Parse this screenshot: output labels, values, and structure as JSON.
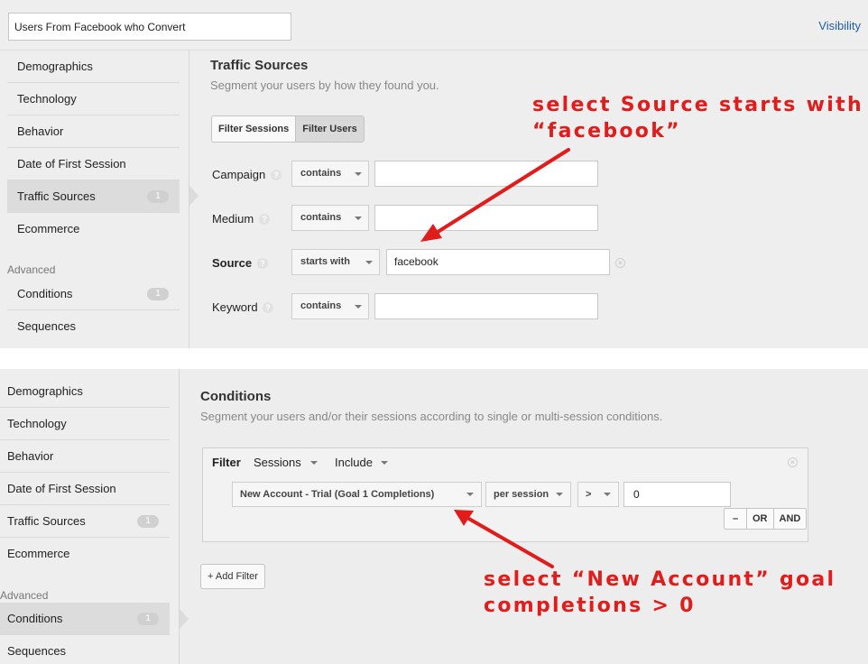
{
  "top_panel": {
    "segment_name": "Users From Facebook who Convert",
    "visibility_link": "Visibility",
    "sidebar": {
      "items": [
        {
          "label": "Demographics",
          "badge": ""
        },
        {
          "label": "Technology",
          "badge": ""
        },
        {
          "label": "Behavior",
          "badge": ""
        },
        {
          "label": "Date of First Session",
          "badge": ""
        },
        {
          "label": "Traffic Sources",
          "badge": "1",
          "active": true
        },
        {
          "label": "Ecommerce",
          "badge": ""
        }
      ],
      "advanced_label": "Advanced",
      "advanced_items": [
        {
          "label": "Conditions",
          "badge": "1"
        },
        {
          "label": "Sequences",
          "badge": ""
        }
      ]
    },
    "section_title": "Traffic Sources",
    "section_subtitle": "Segment your users by how they found you.",
    "toggle": {
      "sessions": "Filter Sessions",
      "users": "Filter Users",
      "selected": "Filter Users"
    },
    "fields": [
      {
        "label": "Campaign",
        "operator": "contains",
        "value": ""
      },
      {
        "label": "Medium",
        "operator": "contains",
        "value": ""
      },
      {
        "label": "Source",
        "operator": "starts with",
        "value": "facebook"
      },
      {
        "label": "Keyword",
        "operator": "contains",
        "value": ""
      }
    ],
    "help_glyph": "?",
    "annotation": "select Source starts with\n“facebook”"
  },
  "bottom_panel": {
    "sidebar": {
      "items": [
        {
          "label": "Demographics",
          "badge": ""
        },
        {
          "label": "Technology",
          "badge": ""
        },
        {
          "label": "Behavior",
          "badge": ""
        },
        {
          "label": "Date of First Session",
          "badge": ""
        },
        {
          "label": "Traffic Sources",
          "badge": "1"
        },
        {
          "label": "Ecommerce",
          "badge": ""
        }
      ],
      "advanced_label": "Advanced",
      "advanced_items": [
        {
          "label": "Conditions",
          "badge": "1",
          "active": true
        },
        {
          "label": "Sequences",
          "badge": ""
        }
      ]
    },
    "section_title": "Conditions",
    "section_subtitle": "Segment your users and/or their sessions according to single or multi-session conditions.",
    "filter": {
      "label": "Filter",
      "scope": "Sessions",
      "mode": "Include",
      "metric": "New Account - Trial (Goal 1 Completions)",
      "aggregation": "per session",
      "comparator": ">",
      "value": "0",
      "logic_buttons": [
        "–",
        "OR",
        "AND"
      ]
    },
    "add_filter": "+ Add Filter",
    "annotation": "select “New Account” goal\ncompletions > 0"
  },
  "colors": {
    "annotation": "#e21b1b",
    "panel_bg": "#eeeeee",
    "link": "#1f5ea8"
  },
  "icons": [
    "help-icon",
    "remove-filter-icon",
    "caret-down-icon",
    "annotation-arrow"
  ]
}
